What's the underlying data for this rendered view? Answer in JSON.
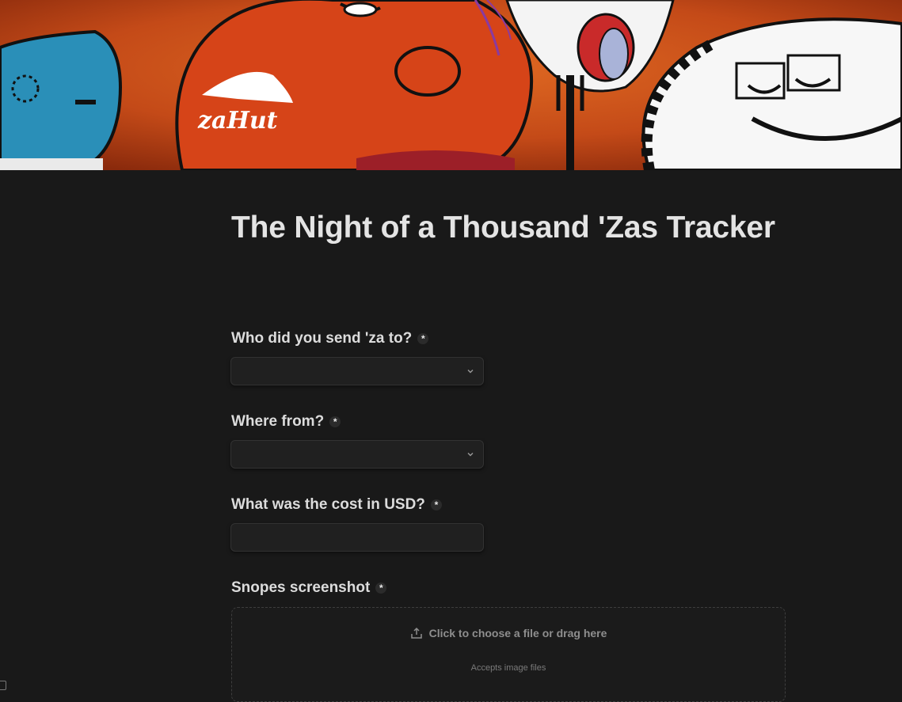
{
  "page": {
    "title": "The Night of a Thousand 'Zas Tracker"
  },
  "banner": {
    "logo_text": "zaHut",
    "alt": "Pizza Hut themed illustration banner"
  },
  "form": {
    "required_marker": "*",
    "fields": [
      {
        "label": "Who did you send 'za to?",
        "type": "select",
        "value": "",
        "icon": "chevron-down-icon"
      },
      {
        "label": "Where from?",
        "type": "select",
        "value": "",
        "icon": "chevron-down-icon"
      },
      {
        "label": "What was the cost in USD?",
        "type": "text",
        "value": ""
      },
      {
        "label": "Snopes screenshot",
        "type": "file"
      }
    ],
    "upload": {
      "prompt": "Click to choose a file or drag here",
      "accepts": "Accepts image files",
      "icon": "upload-icon"
    }
  },
  "colors": {
    "background": "#191919",
    "banner_orange": "#c8501e",
    "input_bg": "#202020",
    "text": "#e4e4e4"
  }
}
